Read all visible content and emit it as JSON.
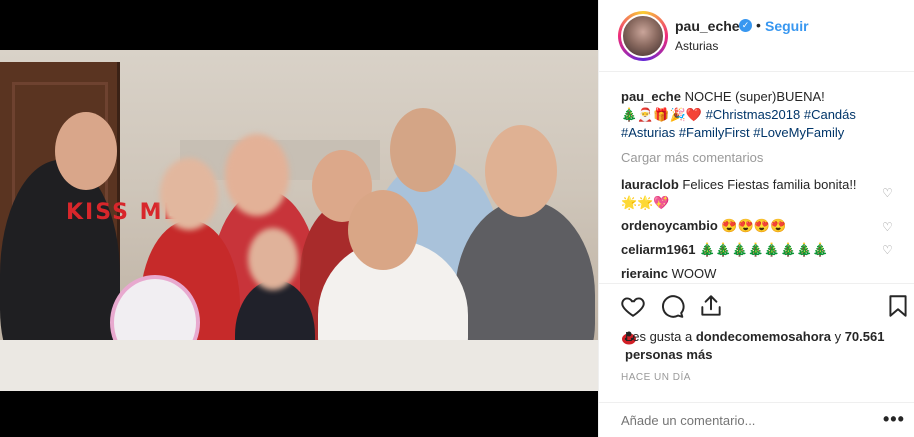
{
  "header": {
    "username": "pau_eche",
    "follow_label": "Seguir",
    "location": "Asturias"
  },
  "caption": {
    "username": "pau_eche",
    "text": "NOCHE (super)BUENA!",
    "emojis": "🎄🎅🎁🎉❤️",
    "hashtags": [
      "#Christmas2018",
      "#Candás",
      "#Asturias",
      "#FamilyFirst",
      "#LoveMyFamily"
    ]
  },
  "load_more_label": "Cargar más comentarios",
  "comments": [
    {
      "user": "lauraclob",
      "text": "Felices Fiestas familia bonita!! 🌟🌟💖"
    },
    {
      "user": "ordenoycambio",
      "text": "😍😍😍😍"
    },
    {
      "user": "celiarm1961",
      "text": "🎄🎄🎄🎄🎄🎄🎄🎄"
    },
    {
      "user": "rierainc",
      "text": "WOOW"
    }
  ],
  "likes": {
    "prefix": "Les gusta a",
    "liker": "dondecomemosahora",
    "connector": "y",
    "others": "70.561 personas más"
  },
  "timestamp": "HACE UN DÍA",
  "add_comment_placeholder": "Añade un comentario...",
  "photo": {
    "sweater_text": "KISS ME"
  }
}
